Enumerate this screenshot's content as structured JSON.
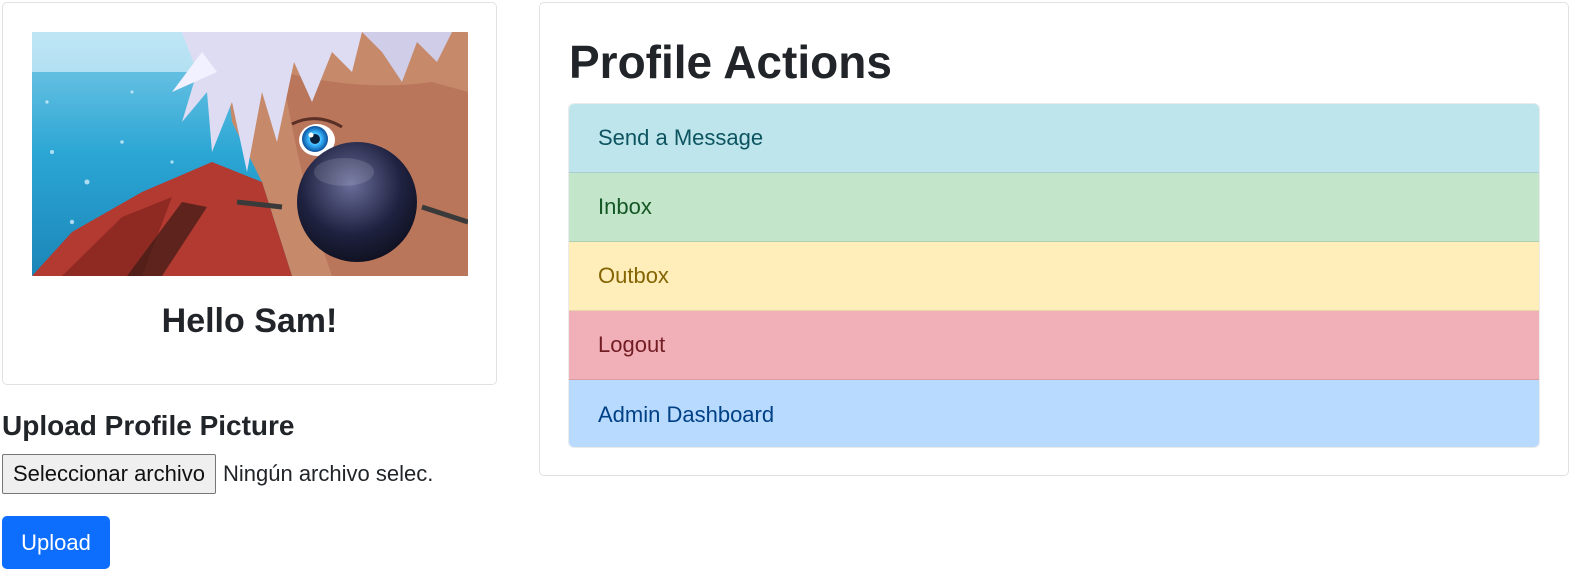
{
  "profile": {
    "greeting": "Hello Sam!",
    "avatar_alt": "Profile picture"
  },
  "upload": {
    "heading": "Upload Profile Picture",
    "file_button_label": "Seleccionar archivo",
    "file_status": "Ningún archivo selec.",
    "submit_label": "Upload",
    "submit_color": "#0d6efd"
  },
  "actions": {
    "title": "Profile Actions",
    "items": [
      {
        "label": "Send a Message",
        "bg": "#bee5eb",
        "fg": "#0c5460"
      },
      {
        "label": "Inbox",
        "bg": "#c3e6cb",
        "fg": "#155724"
      },
      {
        "label": "Outbox",
        "bg": "#ffeeba",
        "fg": "#856404"
      },
      {
        "label": "Logout",
        "bg": "#f1b0b7",
        "fg": "#721c24"
      },
      {
        "label": "Admin Dashboard",
        "bg": "#b8daff",
        "fg": "#004085"
      }
    ]
  }
}
